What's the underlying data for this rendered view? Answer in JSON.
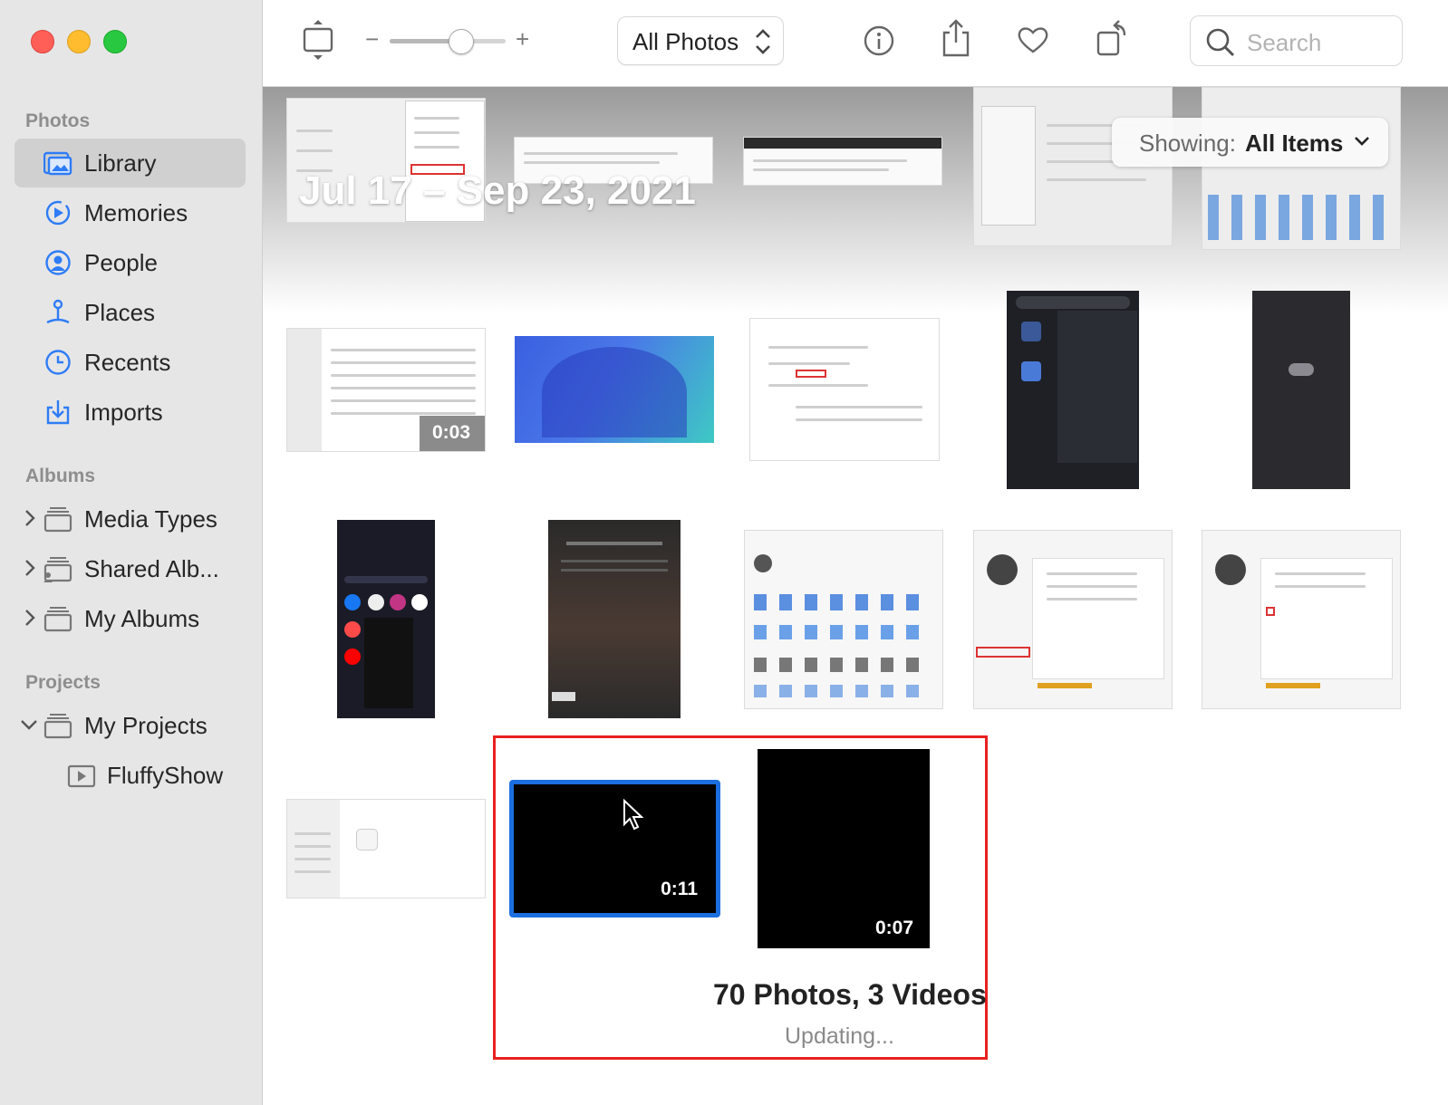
{
  "sidebar": {
    "sections": [
      {
        "title": "Photos"
      },
      {
        "title": "Albums"
      },
      {
        "title": "Projects"
      }
    ],
    "items": [
      {
        "label": "Library",
        "icon": "library-icon"
      },
      {
        "label": "Memories",
        "icon": "memories-icon"
      },
      {
        "label": "People",
        "icon": "people-icon"
      },
      {
        "label": "Places",
        "icon": "places-icon"
      },
      {
        "label": "Recents",
        "icon": "recents-icon"
      },
      {
        "label": "Imports",
        "icon": "imports-icon"
      },
      {
        "label": "Media Types",
        "icon": "album-stack-icon"
      },
      {
        "label": "Shared Alb...",
        "icon": "shared-album-icon"
      },
      {
        "label": "My Albums",
        "icon": "album-stack-icon"
      },
      {
        "label": "My Projects",
        "icon": "album-stack-icon"
      },
      {
        "label": "FluffyShow",
        "icon": "slideshow-icon"
      }
    ],
    "selected": "Library"
  },
  "toolbar": {
    "view_popup_label": "All Photos",
    "zoom_minus": "−",
    "zoom_plus": "+",
    "zoom_level": 0.62,
    "search_placeholder": "Search"
  },
  "content": {
    "date_range": "Jul 17 – Sep 23, 2021",
    "showing_key": "Showing:",
    "showing_value": "All Items",
    "summary": "70 Photos, 3 Videos",
    "status": "Updating...",
    "durations": {
      "video1": "0:03",
      "video2": "0:11",
      "video3": "0:07"
    }
  },
  "colors": {
    "accent": "#1b6fe0",
    "highlight_frame": "#e8211f",
    "sidebar_icon": "#2e7cf6"
  }
}
